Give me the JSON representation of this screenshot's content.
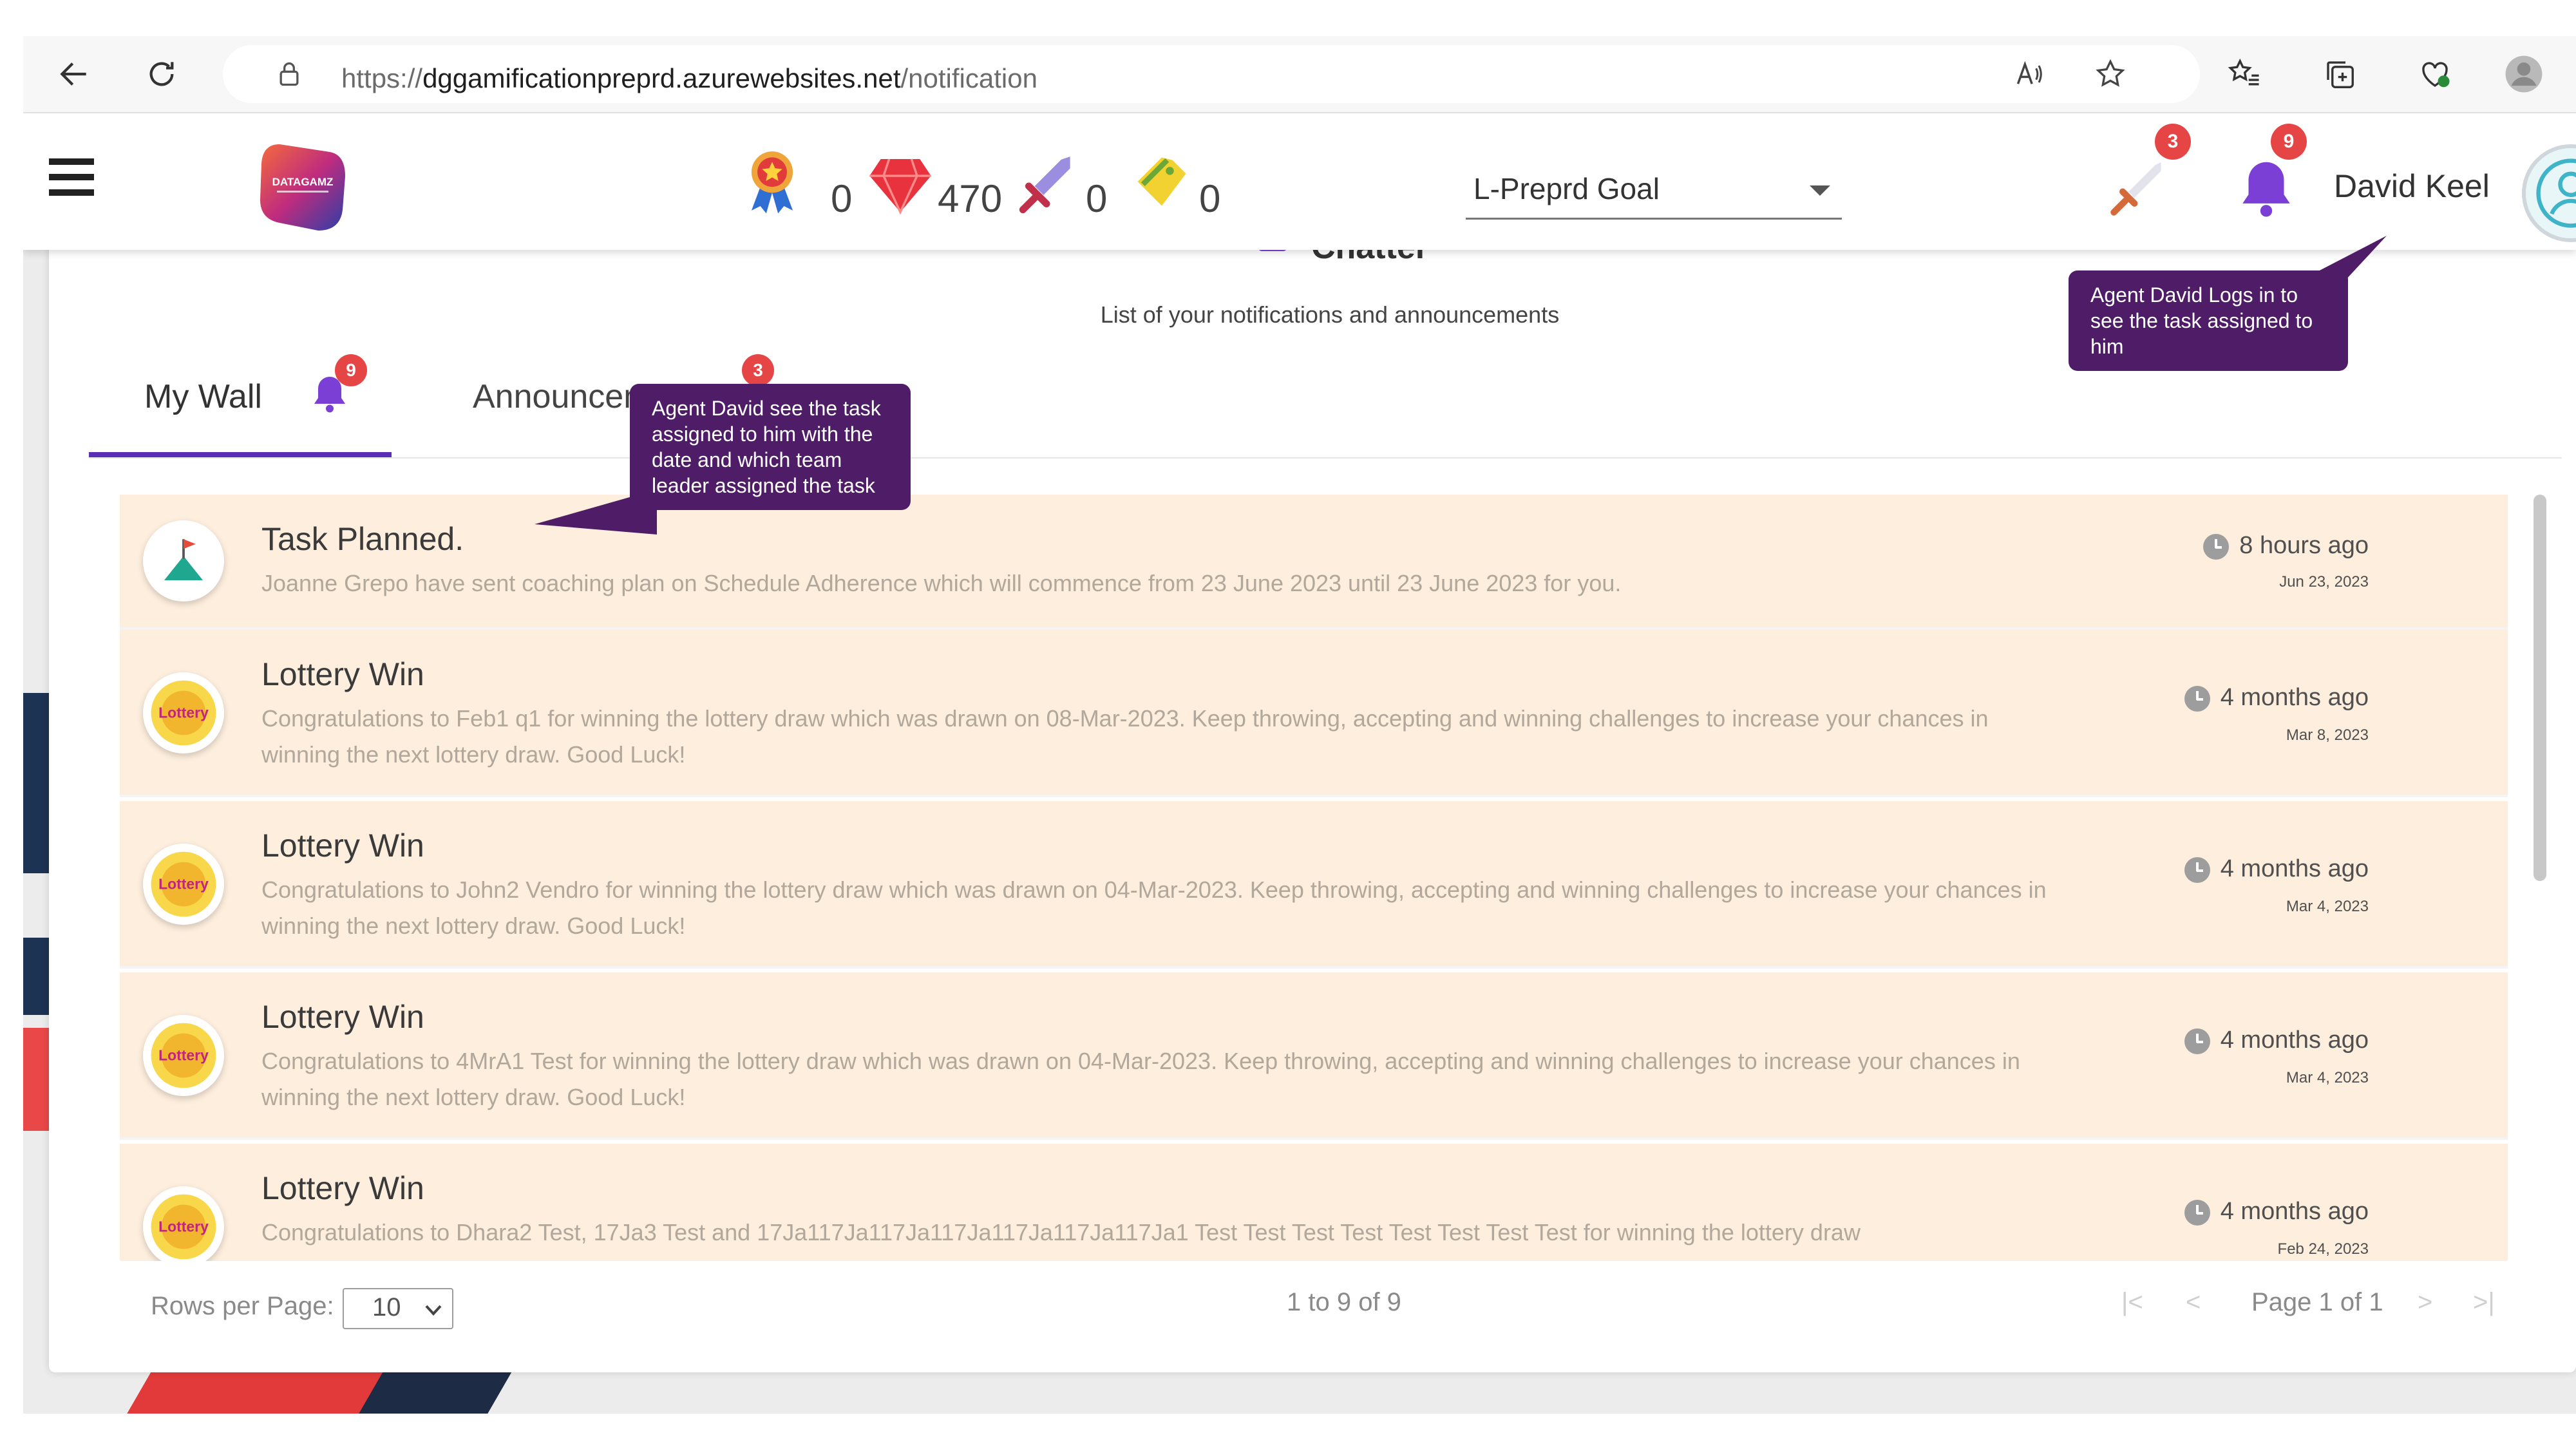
{
  "browser": {
    "url_prefix": "https://",
    "url_host": "dggamificationpreprd.azurewebsites.net",
    "url_path": "/notification"
  },
  "header": {
    "logo_text": "DATAGAMZ",
    "stats": {
      "ribbon_count": "0",
      "gems_count": "470",
      "sword_count": "0",
      "ticket_count": "0"
    },
    "goal_select": "L-Preprd Goal",
    "sword_badge": "3",
    "bell_badge": "9",
    "user_name": "David Keel"
  },
  "page": {
    "title": "Chatter",
    "subtitle": "List of your notifications and announcements"
  },
  "tabs": [
    {
      "label": "My Wall",
      "badge": "9"
    },
    {
      "label": "Announcements",
      "badge": "3"
    }
  ],
  "notifications": [
    {
      "title": "Task Planned.",
      "description": "Joanne Grepo have sent coaching plan on Schedule Adherence which will commence from 23 June 2023 until 23 June 2023 for you.",
      "time_ago": "8 hours ago",
      "date": "Jun 23, 2023",
      "icon": "task-flag-icon"
    },
    {
      "title": "Lottery Win",
      "description": "Congratulations to Feb1 q1 for winning the lottery draw which was drawn on 08-Mar-2023. Keep throwing, accepting and winning challenges to increase your chances in winning the next lottery draw. Good Luck!",
      "time_ago": "4 months ago",
      "date": "Mar 8, 2023",
      "icon": "lottery-icon"
    },
    {
      "title": "Lottery Win",
      "description": "Congratulations to John2 Vendro for winning the lottery draw which was drawn on 04-Mar-2023. Keep throwing, accepting and winning challenges to increase your chances in winning the next lottery draw. Good Luck!",
      "time_ago": "4 months ago",
      "date": "Mar 4, 2023",
      "icon": "lottery-icon"
    },
    {
      "title": "Lottery Win",
      "description": "Congratulations to 4MrA1 Test for winning the lottery draw which was drawn on 04-Mar-2023. Keep throwing, accepting and winning challenges to increase your chances in winning the next lottery draw. Good Luck!",
      "time_ago": "4 months ago",
      "date": "Mar 4, 2023",
      "icon": "lottery-icon"
    },
    {
      "title": "Lottery Win",
      "description": "Congratulations to Dhara2 Test, 17Ja3 Test and 17Ja117Ja117Ja117Ja117Ja117Ja117Ja1 Test Test Test Test Test Test Test Test for winning the lottery draw",
      "time_ago": "4 months ago",
      "date": "Feb 24, 2023",
      "icon": "lottery-icon"
    }
  ],
  "pagination": {
    "rows_label": "Rows per Page:",
    "rows_value": "10",
    "range_text": "1 to 9 of 9",
    "page_text": "Page 1 of 1",
    "first": "|<",
    "prev": "<",
    "next": ">",
    "last": ">|"
  },
  "tooltips": {
    "user": "Agent  David Logs in to see the task assigned to him",
    "task": "Agent  David see the task assigned to him with the date and which team leader assigned the task"
  },
  "colors": {
    "accent": "#5b2fb3",
    "badge": "#e64545",
    "item_bg": "#fdeedd",
    "tooltip": "#4f1c68"
  }
}
